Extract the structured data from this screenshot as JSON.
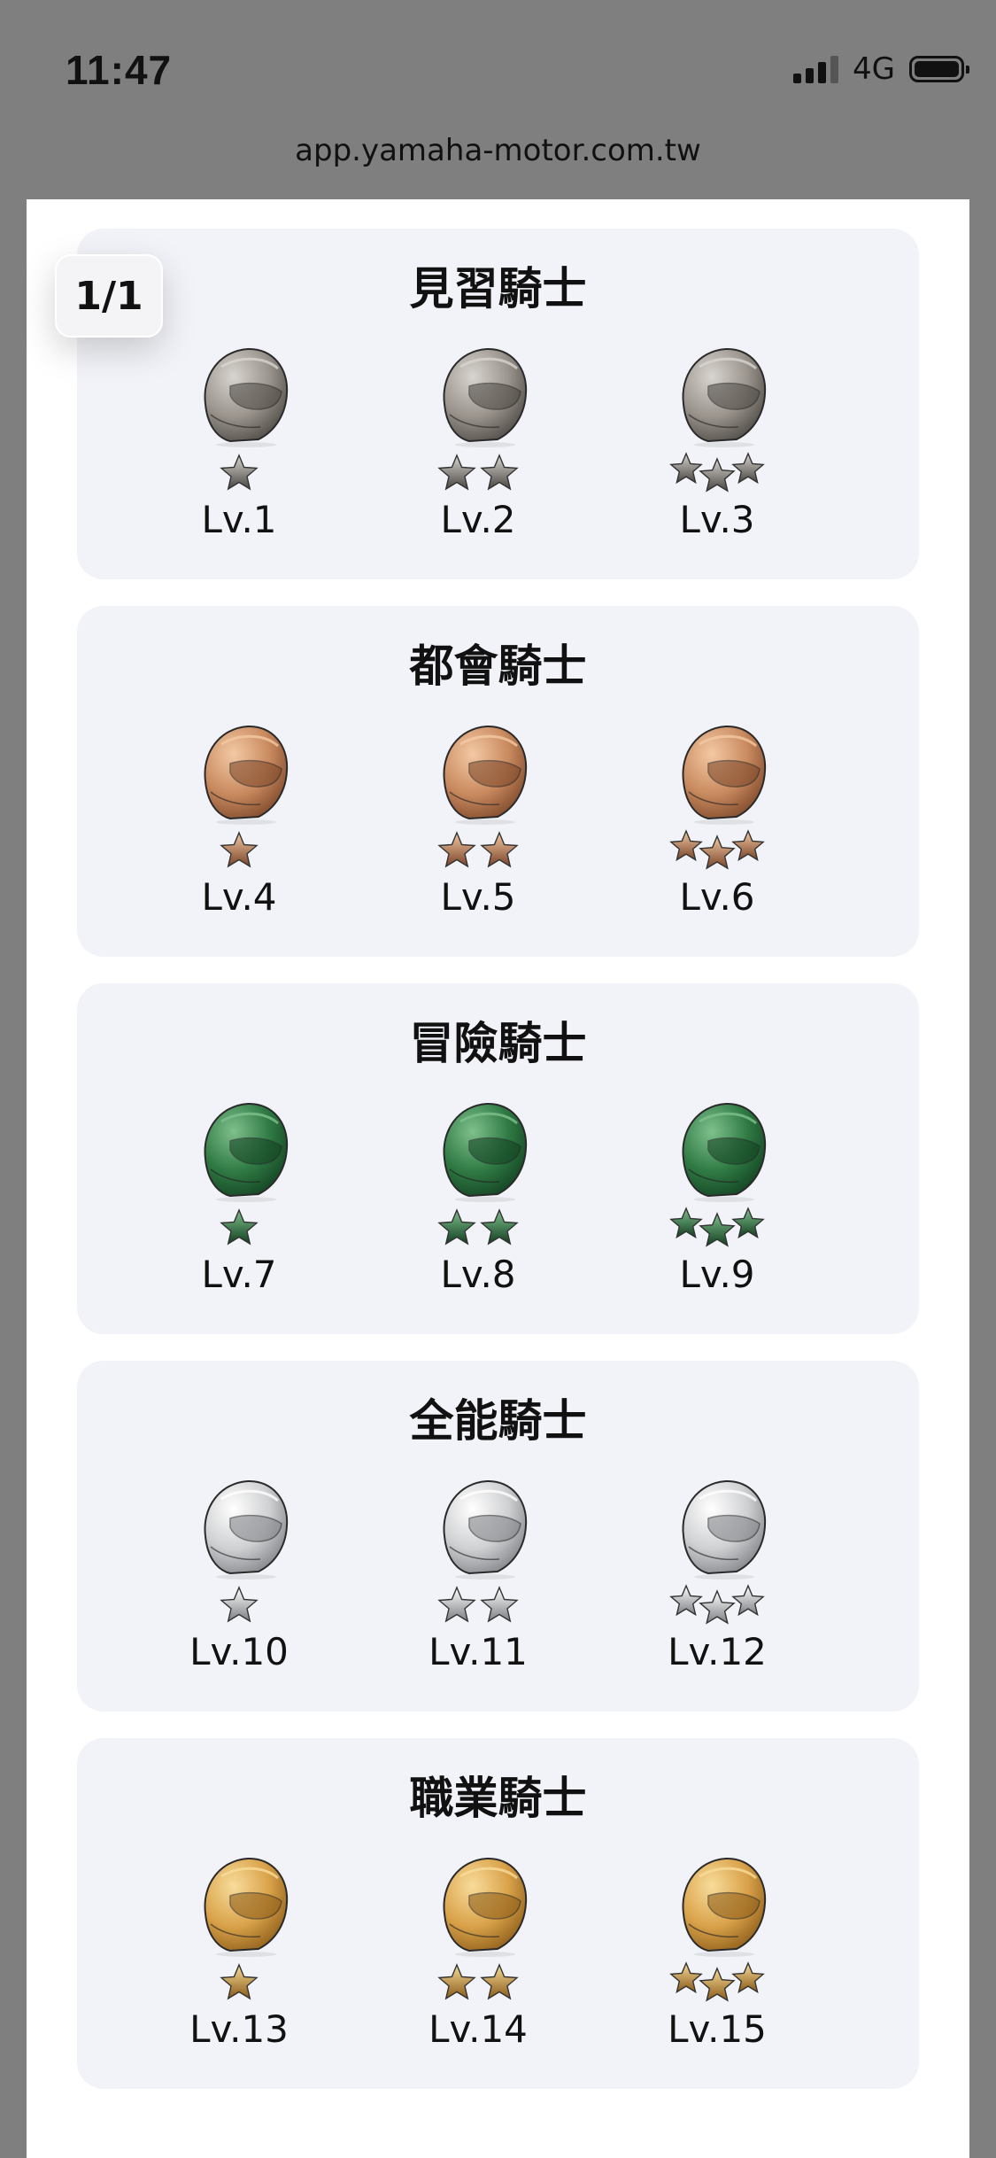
{
  "status_bar": {
    "time": "11:47",
    "network": "4G"
  },
  "browser": {
    "url": "app.yamaha-motor.com.tw"
  },
  "page_indicator": "1/1",
  "tiers": [
    {
      "title": "見習騎士",
      "color": "silver-grey",
      "levels": [
        {
          "label": "Lv.1",
          "stars": 1
        },
        {
          "label": "Lv.2",
          "stars": 2
        },
        {
          "label": "Lv.3",
          "stars": 3
        }
      ]
    },
    {
      "title": "都會騎士",
      "color": "bronze",
      "levels": [
        {
          "label": "Lv.4",
          "stars": 1
        },
        {
          "label": "Lv.5",
          "stars": 2
        },
        {
          "label": "Lv.6",
          "stars": 3
        }
      ]
    },
    {
      "title": "冒險騎士",
      "color": "green",
      "levels": [
        {
          "label": "Lv.7",
          "stars": 1
        },
        {
          "label": "Lv.8",
          "stars": 2
        },
        {
          "label": "Lv.9",
          "stars": 3
        }
      ]
    },
    {
      "title": "全能騎士",
      "color": "silver",
      "levels": [
        {
          "label": "Lv.10",
          "stars": 1
        },
        {
          "label": "Lv.11",
          "stars": 2
        },
        {
          "label": "Lv.12",
          "stars": 3
        }
      ]
    },
    {
      "title": "職業騎士",
      "color": "gold",
      "levels": [
        {
          "label": "Lv.13",
          "stars": 1
        },
        {
          "label": "Lv.14",
          "stars": 2
        },
        {
          "label": "Lv.15",
          "stars": 3
        }
      ]
    }
  ],
  "palette": {
    "silver-grey": {
      "light": "#d8d4cf",
      "mid": "#9a948d",
      "dark": "#4a4641"
    },
    "bronze": {
      "light": "#f3c9a4",
      "mid": "#c98a5f",
      "dark": "#7a4528"
    },
    "green": {
      "light": "#7fc08d",
      "mid": "#2f7a44",
      "dark": "#123f20"
    },
    "silver": {
      "light": "#ffffff",
      "mid": "#cfd0d2",
      "dark": "#7d7f83"
    },
    "gold": {
      "light": "#f8dc9a",
      "mid": "#d9a24a",
      "dark": "#8a5a17"
    }
  }
}
